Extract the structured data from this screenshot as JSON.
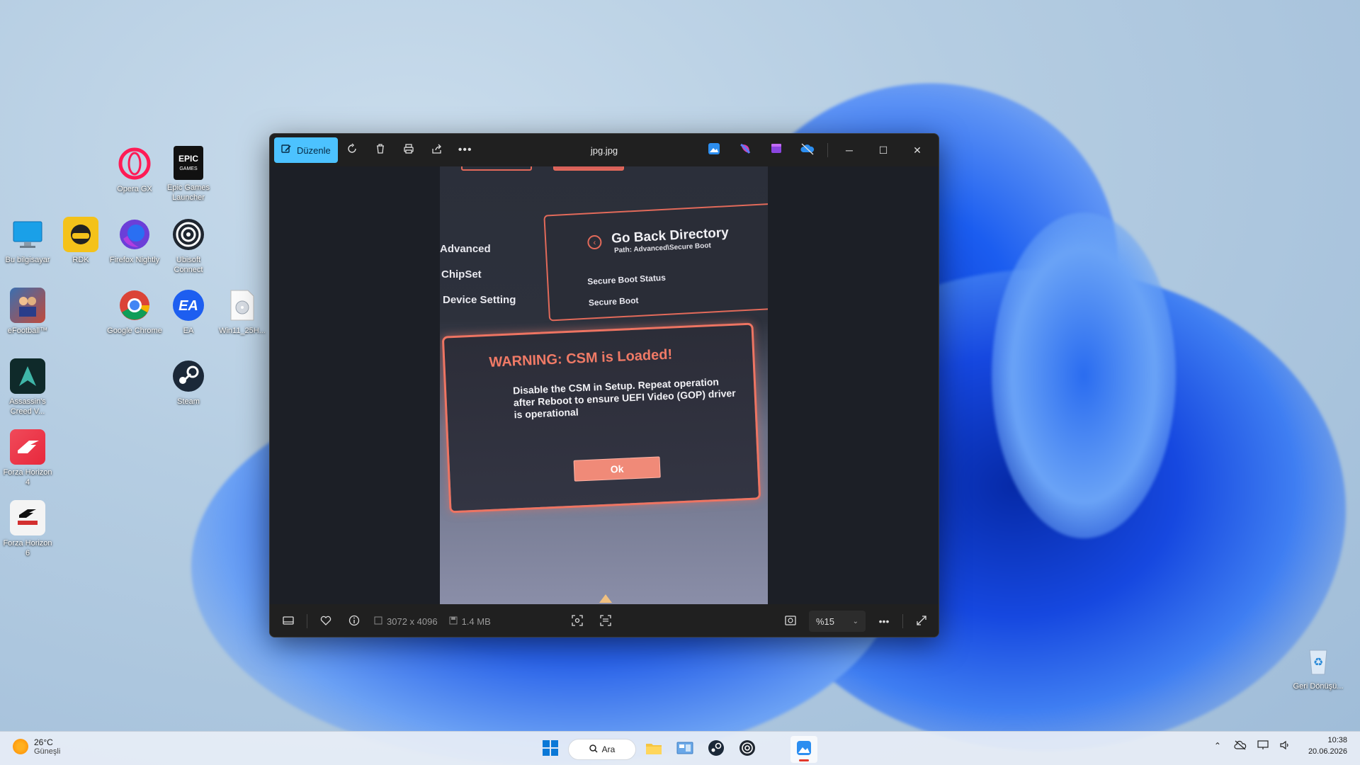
{
  "desktop": {
    "icons": [
      {
        "label": "Opera GX"
      },
      {
        "label": "Epic Games Launcher"
      },
      {
        "label": "Bu bilgisayar"
      },
      {
        "label": "RDK"
      },
      {
        "label": "Firefox Nightly"
      },
      {
        "label": "Ubisoft Connect"
      },
      {
        "label": "eFootball™"
      },
      {
        "label": "Google Chrome"
      },
      {
        "label": "EA"
      },
      {
        "label": "Win11_25H..."
      },
      {
        "label": "Assassin's Creed V..."
      },
      {
        "label": "Steam"
      },
      {
        "label": "Forza Horizon 4"
      },
      {
        "label": "Forza Horizon 6"
      },
      {
        "label": "Geri Dönüşü..."
      }
    ]
  },
  "viewer": {
    "edit_label": "Düzenle",
    "title": "jpg.jpg",
    "dimensions": "3072 x 4096",
    "file_size": "1.4 MB",
    "zoom": "%15"
  },
  "photo": {
    "menu": [
      "Advanced",
      "ChipSet",
      "Device Setting"
    ],
    "panel_title": "Go Back Directory",
    "panel_path": "Path: Advanced\\Secure Boot",
    "panel_rows": [
      "Secure Boot Status",
      "Secure Boot"
    ],
    "warning_title": "WARNING: CSM is Loaded!",
    "warning_body": "Disable the CSM in Setup. Repeat operation after Reboot to ensure UEFI Video (GOP) driver is operational",
    "ok_label": "Ok"
  },
  "taskbar": {
    "temperature": "26°C",
    "condition": "Güneşli",
    "search_label": "Ara",
    "time": "10:38",
    "date": "20.06.2026"
  },
  "colors": {
    "accent": "#4cc2ff",
    "warning": "#f07a66"
  }
}
